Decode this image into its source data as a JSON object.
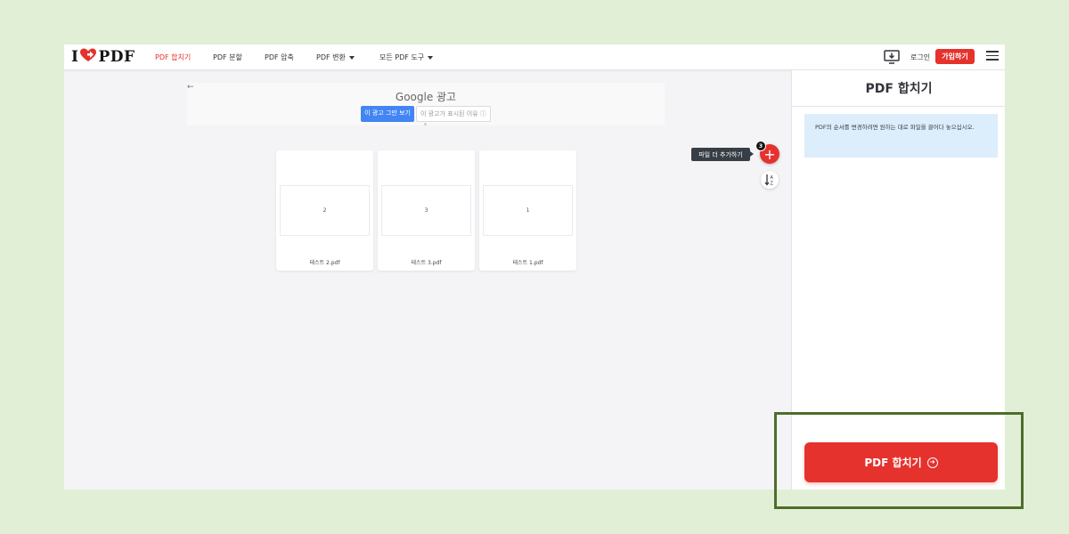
{
  "header": {
    "logo_text_pre": "I",
    "logo_text_post": "PDF",
    "nav": [
      "PDF 합치기",
      "PDF 분할",
      "PDF 압축",
      "PDF 변환",
      "모든 PDF 도구"
    ],
    "login": "로그인",
    "signup": "가입하기"
  },
  "ad": {
    "back": "←",
    "title": "Google 광고",
    "stop_button": "이 광고 그만 보기",
    "why_button": "이 광고가 표시된 이유 ⓘ"
  },
  "files": [
    {
      "page": "2",
      "name": "테스트 2.pdf"
    },
    {
      "page": "3",
      "name": "테스트 3.pdf"
    },
    {
      "page": "1",
      "name": "테스트 1.pdf"
    }
  ],
  "add_files": {
    "tooltip": "파일 더 추가하기",
    "count": "3",
    "plus": "+"
  },
  "sidebar": {
    "title": "PDF 합치기",
    "info": "PDF의 순서를 변경하려면 원하는 대로 파일을 끌어다 놓으십시오.",
    "merge_button": "PDF 합치기"
  },
  "colors": {
    "accent": "#e5322d",
    "page_bg": "#e2efd7",
    "highlight_border": "#4d6e2a",
    "info_bg": "#dcedfb"
  }
}
